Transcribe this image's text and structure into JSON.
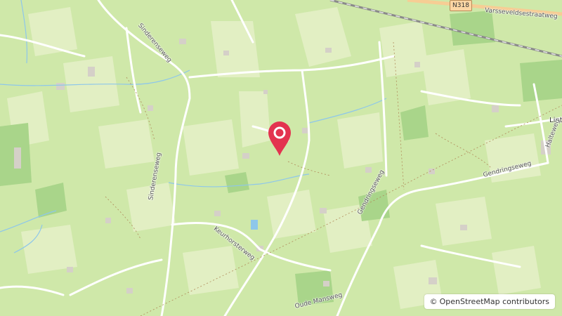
{
  "map": {
    "colors": {
      "land": "#cfe8a9",
      "field_light": "#e2efc3",
      "forest": "#a9d58a",
      "water": "#8ec7ea",
      "road_minor": "#ffffff",
      "road_main": "#f6cd94",
      "railway": "#777777",
      "building": "#d5d0c8",
      "pin": "#e3334f"
    },
    "road_shield": "N318",
    "labels": {
      "sinderenseweg_north": "Sinderenseweg",
      "sinderenseweg_south": "Sinderenseweg",
      "keurhorsterweg": "Keurhorsterweg",
      "gendringseweg_east": "Gendringseweg",
      "gendringseweg_south": "Gendringseweg",
      "varsseveldsestraatweg": "Varsseveldsestraatweg",
      "lintelo": "Lint",
      "halteweg": "Halteweg",
      "mansweg": "Oude Mansweg"
    },
    "attribution": {
      "symbol": "©",
      "text": "OpenStreetMap contributors"
    },
    "marker": {
      "icon": "map-pin-icon"
    }
  }
}
